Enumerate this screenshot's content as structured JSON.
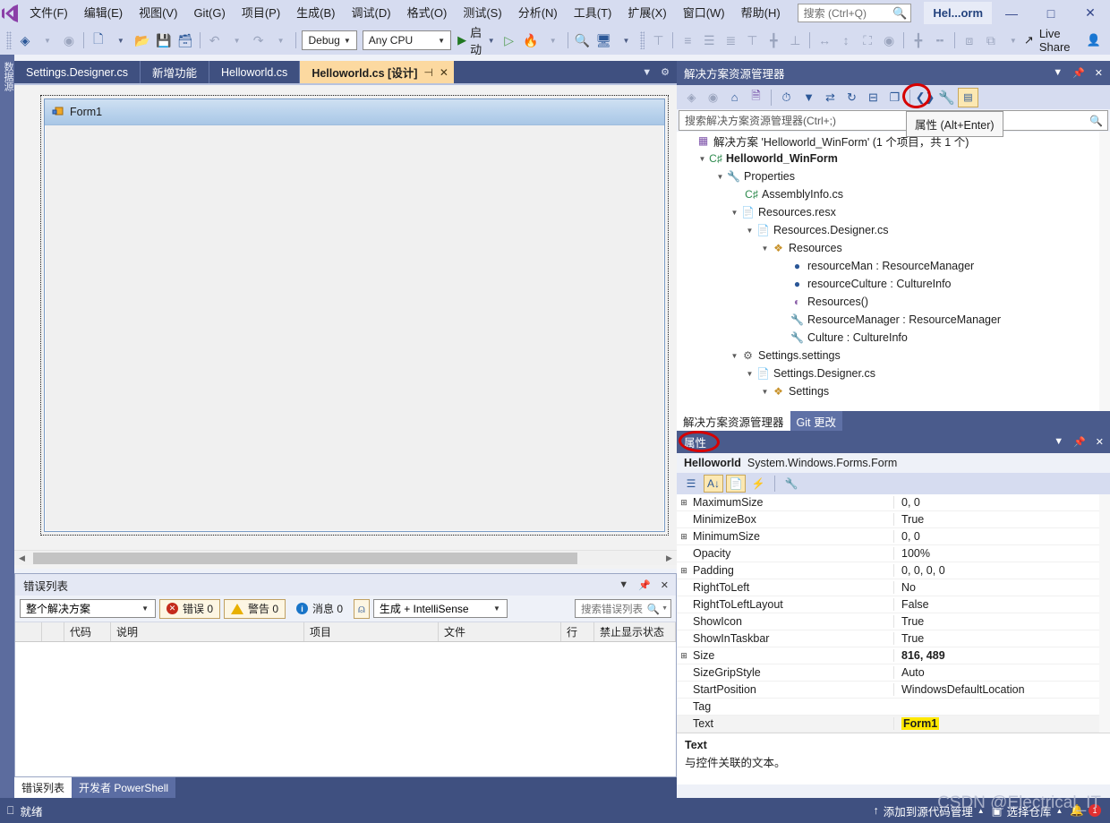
{
  "menu": {
    "logo_name": "visual-studio-logo",
    "items": [
      "文件(F)",
      "编辑(E)",
      "视图(V)",
      "Git(G)",
      "项目(P)",
      "生成(B)",
      "调试(D)",
      "格式(O)",
      "测试(S)",
      "分析(N)",
      "工具(T)",
      "扩展(X)",
      "窗口(W)",
      "帮助(H)"
    ],
    "search_placeholder": "搜索 (Ctrl+Q)",
    "window_title": "Hel...orm",
    "minimize": "—",
    "maximize": "□",
    "close": "✕"
  },
  "toolbar": {
    "back": "◀",
    "forward": "▶",
    "new_project": "new-project",
    "open": "open-file",
    "save": "save",
    "save_all": "save-all",
    "undo": "↶",
    "redo": "↷",
    "config": "Debug",
    "platform": "Any CPU",
    "start_label": "启动",
    "live_share": "Live Share"
  },
  "left_dock": {
    "label": "数据源"
  },
  "tabs": [
    {
      "label": "Settings.Designer.cs",
      "active": false
    },
    {
      "label": "新增功能",
      "active": false
    },
    {
      "label": "Helloworld.cs",
      "active": false
    },
    {
      "label": "Helloworld.cs [设计]",
      "active": true,
      "pin": "⊣",
      "close": "✕"
    }
  ],
  "designer": {
    "form_title": "Form1",
    "form_icon": "winform-icon"
  },
  "error_list": {
    "title": "错误列表",
    "scope": "整个解决方案",
    "errors_label": "错误 0",
    "warnings_label": "警告 0",
    "messages_label": "消息 0",
    "filter_icon": "filter-icon",
    "build_filter": "生成 + IntelliSense",
    "search_placeholder": "搜索错误列表",
    "columns": [
      "",
      "",
      "代码",
      "说明",
      "项目",
      "文件",
      "行",
      "禁止显示状态"
    ],
    "rows": []
  },
  "bottom_tabs": [
    {
      "label": "错误列表",
      "selected": true
    },
    {
      "label": "开发者 PowerShell",
      "selected": false
    }
  ],
  "solution_explorer": {
    "title": "解决方案资源管理器",
    "search_placeholder": "搜索解决方案资源管理器(Ctrl+;)",
    "tooltip": "属性 (Alt+Enter)",
    "tree": [
      {
        "indent": 0,
        "arrow": "",
        "icon": "solution-icon",
        "label": "解决方案 'Helloworld_WinForm' (1 个项目，共 1 个)",
        "bold": false
      },
      {
        "indent": 1,
        "arrow": "▲",
        "icon": "csharp-project-icon",
        "label": "Helloworld_WinForm",
        "bold": true
      },
      {
        "indent": 2,
        "arrow": "▲",
        "icon": "wrench-icon",
        "label": "Properties",
        "bold": false
      },
      {
        "indent": 3,
        "arrow": "",
        "icon": "csharp-file-icon",
        "label": "AssemblyInfo.cs",
        "bold": false
      },
      {
        "indent": 3,
        "arrow": "▲",
        "icon": "resx-icon",
        "label": "Resources.resx",
        "bold": false
      },
      {
        "indent": 4,
        "arrow": "▲",
        "icon": "designer-file-icon",
        "label": "Resources.Designer.cs",
        "bold": false
      },
      {
        "indent": 5,
        "arrow": "▲",
        "icon": "class-icon",
        "label": "Resources",
        "bold": false
      },
      {
        "indent": 6,
        "arrow": "",
        "icon": "field-icon",
        "label": "resourceMan : ResourceManager",
        "bold": false
      },
      {
        "indent": 6,
        "arrow": "",
        "icon": "field-icon",
        "label": "resourceCulture : CultureInfo",
        "bold": false
      },
      {
        "indent": 6,
        "arrow": "",
        "icon": "method-icon",
        "label": "Resources()",
        "bold": false
      },
      {
        "indent": 6,
        "arrow": "",
        "icon": "property-icon",
        "label": "ResourceManager : ResourceManager",
        "bold": false
      },
      {
        "indent": 6,
        "arrow": "",
        "icon": "property-icon",
        "label": "Culture : CultureInfo",
        "bold": false
      },
      {
        "indent": 3,
        "arrow": "▲",
        "icon": "settings-icon",
        "label": "Settings.settings",
        "bold": false
      },
      {
        "indent": 4,
        "arrow": "▲",
        "icon": "designer-file-icon",
        "label": "Settings.Designer.cs",
        "bold": false
      },
      {
        "indent": 5,
        "arrow": "▲",
        "icon": "class-icon",
        "label": "Settings",
        "bold": false
      }
    ],
    "tabs": [
      {
        "label": "解决方案资源管理器",
        "selected": true
      },
      {
        "label": "Git 更改",
        "selected": false
      }
    ]
  },
  "properties": {
    "title": "属性",
    "object_name": "Helloworld",
    "object_type": "System.Windows.Forms.Form",
    "rows": [
      {
        "expand": "⊞",
        "name": "MaximumSize",
        "value": "0, 0",
        "bold": false,
        "highlight": false
      },
      {
        "expand": "",
        "name": "MinimizeBox",
        "value": "True",
        "bold": false,
        "highlight": false
      },
      {
        "expand": "⊞",
        "name": "MinimumSize",
        "value": "0, 0",
        "bold": false,
        "highlight": false
      },
      {
        "expand": "",
        "name": "Opacity",
        "value": "100%",
        "bold": false,
        "highlight": false
      },
      {
        "expand": "⊞",
        "name": "Padding",
        "value": "0, 0, 0, 0",
        "bold": false,
        "highlight": false
      },
      {
        "expand": "",
        "name": "RightToLeft",
        "value": "No",
        "bold": false,
        "highlight": false
      },
      {
        "expand": "",
        "name": "RightToLeftLayout",
        "value": "False",
        "bold": false,
        "highlight": false
      },
      {
        "expand": "",
        "name": "ShowIcon",
        "value": "True",
        "bold": false,
        "highlight": false
      },
      {
        "expand": "",
        "name": "ShowInTaskbar",
        "value": "True",
        "bold": false,
        "highlight": false
      },
      {
        "expand": "⊞",
        "name": "Size",
        "value": "816, 489",
        "bold": true,
        "highlight": false
      },
      {
        "expand": "",
        "name": "SizeGripStyle",
        "value": "Auto",
        "bold": false,
        "highlight": false
      },
      {
        "expand": "",
        "name": "StartPosition",
        "value": "WindowsDefaultLocation",
        "bold": false,
        "highlight": false
      },
      {
        "expand": "",
        "name": "Tag",
        "value": "",
        "bold": false,
        "highlight": false
      },
      {
        "expand": "",
        "name": "Text",
        "value": "Form1",
        "bold": true,
        "highlight": true
      }
    ],
    "description_title": "Text",
    "description_body": "与控件关联的文本。"
  },
  "status_bar": {
    "ready": "就绪",
    "source_control": "添加到源代码管理",
    "select_repo": "选择仓库",
    "notification_count": "1"
  },
  "watermark": "CSDN @Electrical_IT",
  "colors": {
    "menu_bg": "#d6dcf0",
    "chrome_blue": "#3f5080",
    "panel_header": "#4a5b8c",
    "active_tab": "#fcd9a0",
    "highlight_yellow": "#ffe800",
    "annotation_red": "#d60000"
  }
}
